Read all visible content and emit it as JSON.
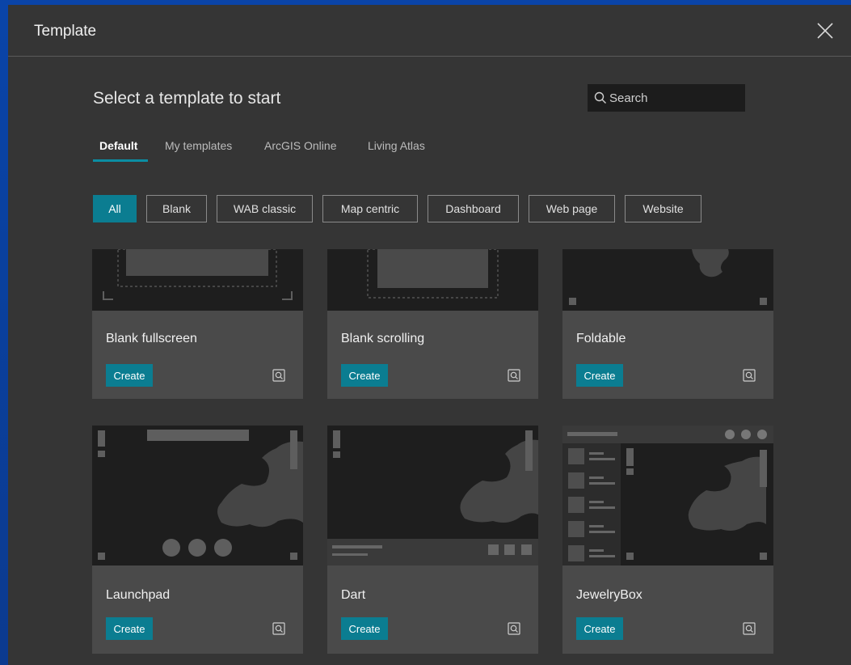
{
  "dialog": {
    "title": "Template",
    "heading": "Select a template to start",
    "search": {
      "placeholder": "Search"
    },
    "tabs": [
      {
        "label": "Default",
        "active": true
      },
      {
        "label": "My templates",
        "active": false
      },
      {
        "label": "ArcGIS Online",
        "active": false
      },
      {
        "label": "Living Atlas",
        "active": false
      }
    ],
    "filters": [
      {
        "label": "All",
        "active": true
      },
      {
        "label": "Blank",
        "active": false
      },
      {
        "label": "WAB classic",
        "active": false
      },
      {
        "label": "Map centric",
        "active": false
      },
      {
        "label": "Dashboard",
        "active": false
      },
      {
        "label": "Web page",
        "active": false
      },
      {
        "label": "Website",
        "active": false
      }
    ],
    "cards": [
      {
        "name": "Blank fullscreen",
        "create_label": "Create"
      },
      {
        "name": "Blank scrolling",
        "create_label": "Create"
      },
      {
        "name": "Foldable",
        "create_label": "Create"
      },
      {
        "name": "Launchpad",
        "create_label": "Create"
      },
      {
        "name": "Dart",
        "create_label": "Create"
      },
      {
        "name": "JewelryBox",
        "create_label": "Create"
      }
    ]
  },
  "colors": {
    "accent": "#0b7d91",
    "dialog_bg": "#353535",
    "card_bg": "#4a4a4a",
    "thumb_bg": "#1e1e1e"
  },
  "icons": {
    "close": "close-icon",
    "search": "search-icon",
    "preview": "preview-icon"
  }
}
